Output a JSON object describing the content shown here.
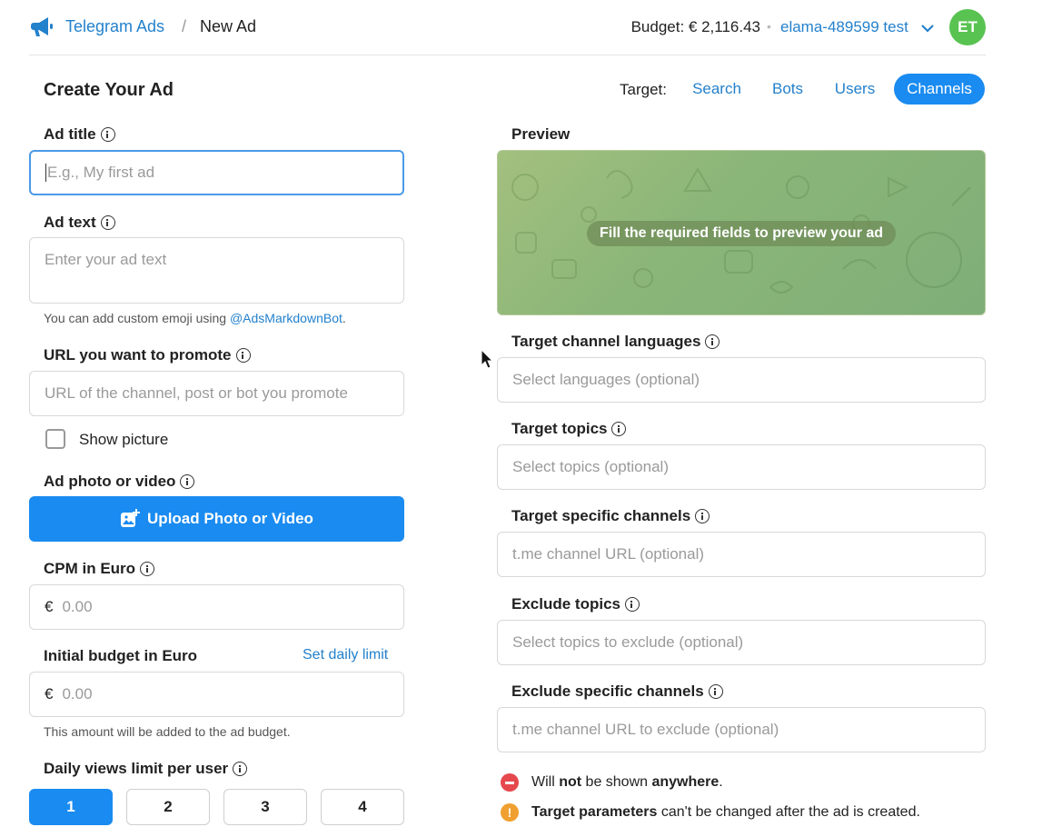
{
  "header": {
    "brand": "Telegram Ads",
    "separator": "/",
    "page": "New Ad",
    "budget": "Budget: € 2,116.43",
    "dot": "•",
    "account": "elama-489599 test",
    "avatar_initials": "ET",
    "avatar_color": "#59c351",
    "accent_color": "#2481cc"
  },
  "form": {
    "title": "Create Your Ad",
    "ad_title_label": "Ad title",
    "ad_title_placeholder": "E.g., My first ad",
    "ad_text_label": "Ad text",
    "ad_text_placeholder": "Enter your ad text",
    "emoji_hint": "You can add custom emoji using ",
    "emoji_bot": "@AdsMarkdownBot",
    "emoji_hint_end": ".",
    "url_label": "URL you want to promote",
    "url_placeholder": "URL of the channel, post or bot you promote",
    "show_picture_label": "Show picture",
    "show_picture_checked": false,
    "photo_label": "Ad photo or video",
    "upload_button": "Upload Photo or Video",
    "cpm_label": "CPM in Euro",
    "currency": "€",
    "cpm_placeholder": "0.00",
    "budget_label": "Initial budget in Euro",
    "daily_limit_link": "Set daily limit",
    "budget_placeholder": "0.00",
    "budget_hint": "This amount will be added to the ad budget.",
    "views_label": "Daily views limit per user",
    "views_options": [
      "1",
      "2",
      "3",
      "4"
    ],
    "views_selected": "1"
  },
  "targeting": {
    "label": "Target:",
    "tabs": [
      "Search",
      "Bots",
      "Users",
      "Channels"
    ],
    "active_tab": "Channels",
    "preview_label": "Preview",
    "preview_message": "Fill the required fields to preview your ad",
    "languages_label": "Target channel languages",
    "languages_placeholder": "Select languages (optional)",
    "topics_label": "Target topics",
    "topics_placeholder": "Select topics (optional)",
    "channels_label": "Target specific channels",
    "channels_placeholder": "t.me channel URL (optional)",
    "exclude_topics_label": "Exclude topics",
    "exclude_topics_placeholder": "Select topics to exclude (optional)",
    "exclude_channels_label": "Exclude specific channels",
    "exclude_channels_placeholder": "t.me channel URL to exclude (optional)"
  },
  "notices": {
    "warning_1_pre": "Will ",
    "warning_1_bold1": "not",
    "warning_1_mid": " be shown ",
    "warning_1_bold2": "anywhere",
    "warning_1_end": ".",
    "warning_2_bold": "Target parameters",
    "warning_2_rest": " can't be changed after the ad is created.",
    "warning_2_icon": "!"
  }
}
